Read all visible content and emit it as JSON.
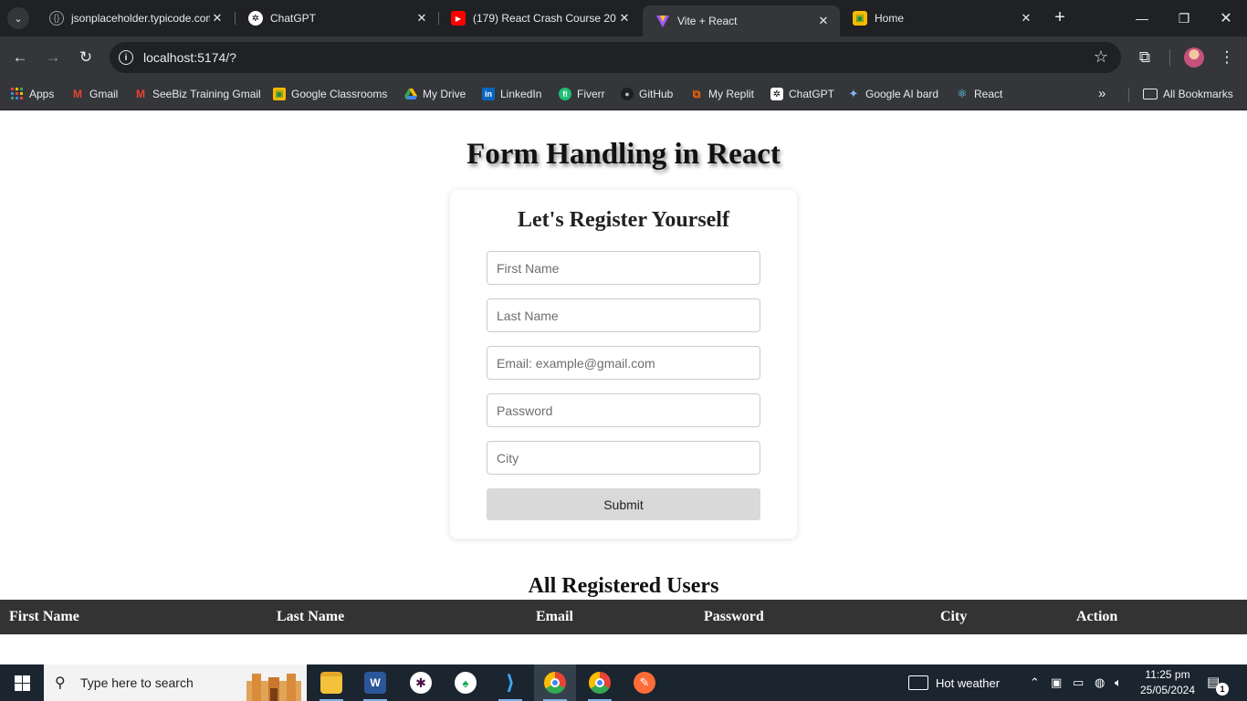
{
  "browser": {
    "tabs": [
      {
        "title": "jsonplaceholder.typicode.com",
        "favicon": "jsonplaceholder-icon"
      },
      {
        "title": "ChatGPT",
        "favicon": "chatgpt-icon"
      },
      {
        "title": "(179) React Crash Course 20",
        "favicon": "youtube-icon"
      },
      {
        "title": "Vite + React",
        "favicon": "vite-icon",
        "active": true
      },
      {
        "title": "Home",
        "favicon": "classroom-icon"
      }
    ],
    "url": "localhost:5174/?",
    "bookmarks": [
      {
        "label": "Apps",
        "icon": "apps-grid-icon"
      },
      {
        "label": "Gmail",
        "icon": "gmail-icon"
      },
      {
        "label": "SeeBiz Training Gmail",
        "icon": "gmail-icon"
      },
      {
        "label": "Google Classrooms",
        "icon": "classroom-icon"
      },
      {
        "label": "My Drive",
        "icon": "drive-icon"
      },
      {
        "label": "LinkedIn",
        "icon": "linkedin-icon"
      },
      {
        "label": "Fiverr",
        "icon": "fiverr-icon"
      },
      {
        "label": "GitHub",
        "icon": "github-icon"
      },
      {
        "label": "My Replit",
        "icon": "replit-icon"
      },
      {
        "label": "ChatGPT",
        "icon": "chatgpt-icon"
      },
      {
        "label": "Google AI bard",
        "icon": "bard-icon"
      },
      {
        "label": "React",
        "icon": "react-icon"
      }
    ],
    "all_bookmarks": "All Bookmarks"
  },
  "page": {
    "title": "Form Handling in React",
    "form": {
      "title": "Let's Register Yourself",
      "first_name_placeholder": "First Name",
      "last_name_placeholder": "Last Name",
      "email_placeholder": "Email: example@gmail.com",
      "password_placeholder": "Password",
      "city_placeholder": "City",
      "submit_label": "Submit"
    },
    "users": {
      "title": "All Registered Users",
      "columns": [
        "First Name",
        "Last Name",
        "Email",
        "Password",
        "City",
        "Action"
      ]
    }
  },
  "taskbar": {
    "search_placeholder": "Type here to search",
    "weather": "Hot weather",
    "time": "11:25 pm",
    "date": "25/05/2024",
    "notification_count": "1"
  },
  "colors": {
    "chrome_frame": "#202124",
    "chrome_toolbar": "#35363a",
    "table_header": "#333333",
    "submit_button": "#d9d9d9",
    "taskbar": "#1b2530"
  }
}
